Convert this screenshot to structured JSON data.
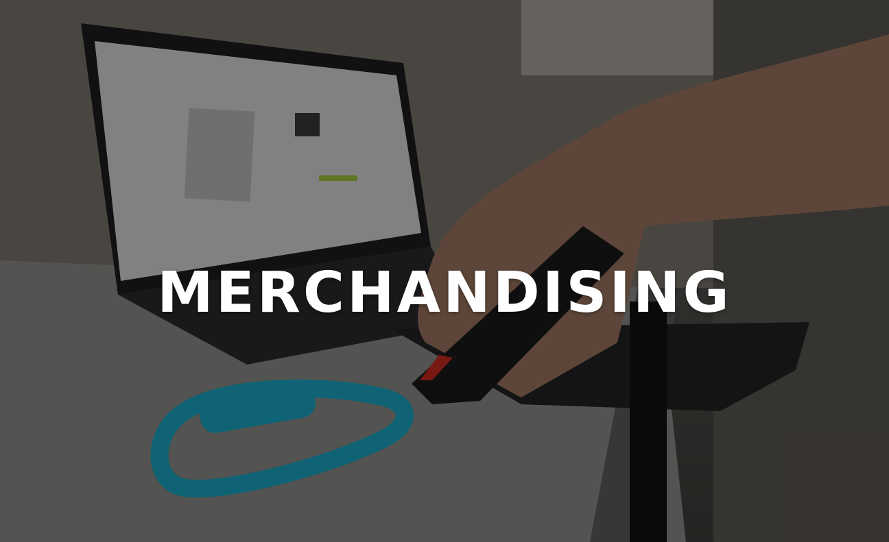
{
  "hero": {
    "title": "MERCHANDISING"
  },
  "colors": {
    "overlay": "rgba(0,0,0,0.40)",
    "title": "#ffffff",
    "carabiner": "#1aa6c1",
    "table": "#8e8e8c"
  },
  "image": {
    "icon": "photo-scene"
  }
}
